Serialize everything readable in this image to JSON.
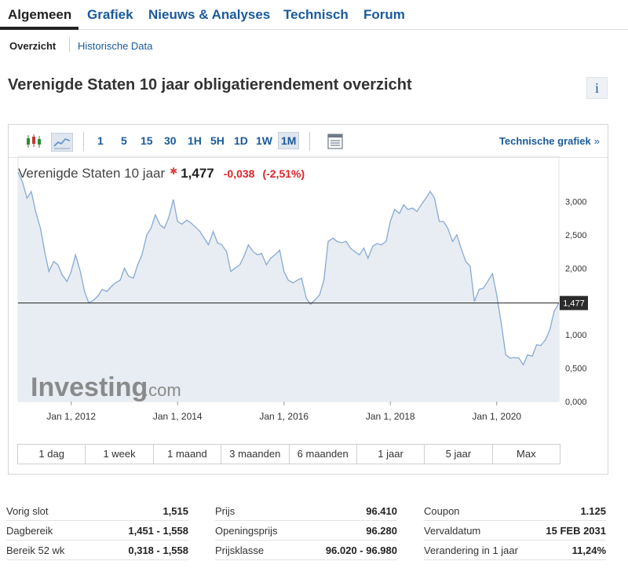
{
  "tabs": [
    {
      "label": "Algemeen"
    },
    {
      "label": "Grafiek"
    },
    {
      "label": "Nieuws & Analyses"
    },
    {
      "label": "Technisch"
    },
    {
      "label": "Forum"
    }
  ],
  "subtabs": [
    {
      "label": "Overzicht"
    },
    {
      "label": "Historische Data"
    }
  ],
  "page": {
    "title": "Verenigde Staten 10 jaar obligatierendement overzicht",
    "info_icon": "i"
  },
  "toolbar": {
    "periods": [
      "1",
      "5",
      "15",
      "30",
      "1H",
      "5H",
      "1D",
      "1W",
      "1M"
    ],
    "active_period": "1M",
    "technical_link": "Technische grafiek",
    "technical_chevron": "»"
  },
  "quote": {
    "name": "Verenigde Staten 10 jaar",
    "star": "✱",
    "last": "1,477",
    "change": "-0,038",
    "change_pct": "(-2,51%)"
  },
  "colors": {
    "accent": "#1a5a99",
    "negative": "#d9262c",
    "line": "#86a9d4",
    "fill": "#e8edf3"
  },
  "chart_data": {
    "type": "area",
    "watermark_main": "Investing",
    "watermark_suffix": ".com",
    "current_label": "1,477",
    "current_value": 1.477,
    "ylim": [
      0,
      3.5
    ],
    "y_ticks": [
      {
        "value": 3.0,
        "label": "3,000"
      },
      {
        "value": 2.5,
        "label": "2,500"
      },
      {
        "value": 2.0,
        "label": "2,000"
      },
      {
        "value": 1.0,
        "label": "1,000"
      },
      {
        "value": 0.5,
        "label": "0,500"
      },
      {
        "value": 0.0,
        "label": "0,000"
      }
    ],
    "x_ticks": [
      {
        "t": 2012.0,
        "label": "Jan 1, 2012"
      },
      {
        "t": 2014.0,
        "label": "Jan 1, 2014"
      },
      {
        "t": 2016.0,
        "label": "Jan 1, 2016"
      },
      {
        "t": 2018.0,
        "label": "Jan 1, 2018"
      },
      {
        "t": 2020.0,
        "label": "Jan 1, 2020"
      }
    ],
    "x_range": [
      2011.0,
      2021.17
    ],
    "series": [
      {
        "points": [
          [
            2011.0,
            3.44
          ],
          [
            2011.08,
            3.3
          ],
          [
            2011.17,
            3.05
          ],
          [
            2011.25,
            3.15
          ],
          [
            2011.33,
            2.85
          ],
          [
            2011.42,
            2.6
          ],
          [
            2011.5,
            2.25
          ],
          [
            2011.58,
            1.95
          ],
          [
            2011.67,
            2.1
          ],
          [
            2011.75,
            2.05
          ],
          [
            2011.83,
            1.9
          ],
          [
            2011.92,
            1.8
          ],
          [
            2012.0,
            1.95
          ],
          [
            2012.08,
            2.2
          ],
          [
            2012.17,
            1.95
          ],
          [
            2012.25,
            1.65
          ],
          [
            2012.33,
            1.48
          ],
          [
            2012.42,
            1.52
          ],
          [
            2012.5,
            1.58
          ],
          [
            2012.58,
            1.68
          ],
          [
            2012.67,
            1.65
          ],
          [
            2012.75,
            1.72
          ],
          [
            2012.83,
            1.78
          ],
          [
            2012.92,
            1.82
          ],
          [
            2013.0,
            2.0
          ],
          [
            2013.08,
            1.88
          ],
          [
            2013.17,
            1.85
          ],
          [
            2013.25,
            2.05
          ],
          [
            2013.33,
            2.2
          ],
          [
            2013.42,
            2.5
          ],
          [
            2013.5,
            2.6
          ],
          [
            2013.58,
            2.8
          ],
          [
            2013.67,
            2.65
          ],
          [
            2013.75,
            2.6
          ],
          [
            2013.83,
            2.75
          ],
          [
            2013.92,
            3.03
          ],
          [
            2014.0,
            2.7
          ],
          [
            2014.08,
            2.66
          ],
          [
            2014.17,
            2.72
          ],
          [
            2014.25,
            2.68
          ],
          [
            2014.33,
            2.62
          ],
          [
            2014.42,
            2.55
          ],
          [
            2014.5,
            2.45
          ],
          [
            2014.58,
            2.35
          ],
          [
            2014.67,
            2.55
          ],
          [
            2014.75,
            2.38
          ],
          [
            2014.83,
            2.35
          ],
          [
            2014.92,
            2.25
          ],
          [
            2015.0,
            1.95
          ],
          [
            2015.08,
            2.0
          ],
          [
            2015.17,
            2.05
          ],
          [
            2015.25,
            2.18
          ],
          [
            2015.33,
            2.35
          ],
          [
            2015.42,
            2.25
          ],
          [
            2015.5,
            2.2
          ],
          [
            2015.58,
            2.22
          ],
          [
            2015.67,
            2.05
          ],
          [
            2015.75,
            2.15
          ],
          [
            2015.83,
            2.2
          ],
          [
            2015.92,
            2.27
          ],
          [
            2016.0,
            1.95
          ],
          [
            2016.08,
            1.82
          ],
          [
            2016.17,
            1.78
          ],
          [
            2016.25,
            1.82
          ],
          [
            2016.33,
            1.85
          ],
          [
            2016.42,
            1.55
          ],
          [
            2016.5,
            1.46
          ],
          [
            2016.58,
            1.52
          ],
          [
            2016.67,
            1.6
          ],
          [
            2016.75,
            1.82
          ],
          [
            2016.83,
            2.4
          ],
          [
            2016.92,
            2.45
          ],
          [
            2017.0,
            2.4
          ],
          [
            2017.08,
            2.38
          ],
          [
            2017.17,
            2.4
          ],
          [
            2017.25,
            2.3
          ],
          [
            2017.33,
            2.25
          ],
          [
            2017.42,
            2.2
          ],
          [
            2017.5,
            2.3
          ],
          [
            2017.58,
            2.15
          ],
          [
            2017.67,
            2.33
          ],
          [
            2017.75,
            2.37
          ],
          [
            2017.83,
            2.35
          ],
          [
            2017.92,
            2.4
          ],
          [
            2018.0,
            2.7
          ],
          [
            2018.08,
            2.88
          ],
          [
            2018.17,
            2.82
          ],
          [
            2018.25,
            2.95
          ],
          [
            2018.33,
            2.88
          ],
          [
            2018.42,
            2.9
          ],
          [
            2018.5,
            2.85
          ],
          [
            2018.58,
            2.95
          ],
          [
            2018.67,
            3.05
          ],
          [
            2018.75,
            3.15
          ],
          [
            2018.83,
            3.05
          ],
          [
            2018.92,
            2.7
          ],
          [
            2019.0,
            2.7
          ],
          [
            2019.08,
            2.6
          ],
          [
            2019.17,
            2.4
          ],
          [
            2019.25,
            2.5
          ],
          [
            2019.33,
            2.3
          ],
          [
            2019.42,
            2.1
          ],
          [
            2019.5,
            2.03
          ],
          [
            2019.58,
            1.5
          ],
          [
            2019.67,
            1.68
          ],
          [
            2019.75,
            1.7
          ],
          [
            2019.83,
            1.8
          ],
          [
            2019.92,
            1.92
          ],
          [
            2020.0,
            1.6
          ],
          [
            2020.08,
            1.2
          ],
          [
            2020.17,
            0.7
          ],
          [
            2020.25,
            0.65
          ],
          [
            2020.33,
            0.66
          ],
          [
            2020.42,
            0.65
          ],
          [
            2020.5,
            0.55
          ],
          [
            2020.58,
            0.7
          ],
          [
            2020.67,
            0.68
          ],
          [
            2020.75,
            0.85
          ],
          [
            2020.83,
            0.84
          ],
          [
            2020.92,
            0.93
          ],
          [
            2021.0,
            1.08
          ],
          [
            2021.08,
            1.35
          ],
          [
            2021.17,
            1.477
          ]
        ]
      }
    ]
  },
  "ranges": [
    "1 dag",
    "1 week",
    "1 maand",
    "3 maanden",
    "6 maanden",
    "1 jaar",
    "5 jaar",
    "Max"
  ],
  "stats": [
    [
      {
        "label": "Vorig slot",
        "value": "1,515"
      },
      {
        "label": "Dagbereik",
        "value": "1,451 - 1,558"
      },
      {
        "label": "Bereik 52 wk",
        "value": "0,318 - 1,558"
      }
    ],
    [
      {
        "label": "Prijs",
        "value": "96.410"
      },
      {
        "label": "Openingsprijs",
        "value": "96.280"
      },
      {
        "label": "Prijsklasse",
        "value": "96.020 - 96.980"
      }
    ],
    [
      {
        "label": "Coupon",
        "value": "1.125"
      },
      {
        "label": "Vervaldatum",
        "value": "15 FEB 2031"
      },
      {
        "label": "Verandering in 1 jaar",
        "value": "11,24%"
      }
    ]
  ]
}
